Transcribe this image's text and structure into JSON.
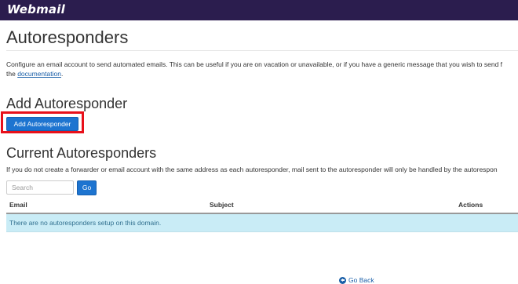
{
  "header": {
    "logo_text": "Webmail",
    "background_color": "#2b1d4e"
  },
  "page": {
    "title": "Autoresponders",
    "intro_text": "Configure an email account to send automated emails. This can be useful if you are on vacation or unavailable, or if you have a generic message that you wish to send f",
    "intro_prefix": "the ",
    "documentation_link": "documentation",
    "intro_suffix": "."
  },
  "add_section": {
    "title": "Add Autoresponder",
    "button_label": "Add Autoresponder",
    "highlight_color": "#e8101a"
  },
  "current_section": {
    "title": "Current Autoresponders",
    "note": "If you do not create a forwarder or email account with the same address as each autoresponder, mail sent to the autoresponder will only be handled by the autorespon"
  },
  "search": {
    "placeholder": "Search",
    "value": "",
    "button_label": "Go"
  },
  "table": {
    "columns": [
      "Email",
      "Subject",
      "Actions"
    ],
    "rows": [],
    "empty_message": "There are no autoresponders setup on this domain."
  },
  "footer": {
    "go_back_label": "Go Back"
  },
  "colors": {
    "primary_button": "#1d74d0",
    "link": "#1a5fa8",
    "info_row": "#c9ecf6"
  }
}
